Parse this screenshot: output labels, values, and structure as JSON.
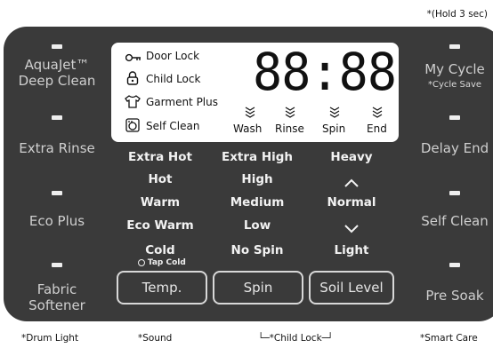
{
  "top_note": "*(Hold 3 sec)",
  "left": [
    {
      "label": "AquaJet™\nDeep Clean"
    },
    {
      "label": "Extra Rinse"
    },
    {
      "label": "Eco Plus"
    },
    {
      "label": "Fabric\nSoftener"
    }
  ],
  "right": [
    {
      "label": "My Cycle",
      "sub": "*Cycle Save"
    },
    {
      "label": "Delay End"
    },
    {
      "label": "Self Clean"
    },
    {
      "label": "Pre Soak"
    }
  ],
  "lcd": {
    "indicators": [
      "Door Lock",
      "Child Lock",
      "Garment Plus",
      "Self Clean"
    ],
    "time": "88:88",
    "stages": [
      "Wash",
      "Rinse",
      "Spin",
      "End"
    ]
  },
  "temp": [
    "Extra Hot",
    "Hot",
    "Warm",
    "Eco Warm",
    "Cold"
  ],
  "tap_cold": "Tap Cold",
  "spin": [
    "Extra High",
    "High",
    "Medium",
    "Low",
    "No Spin"
  ],
  "soil": [
    "Heavy",
    "^",
    "Normal",
    "v",
    "Light"
  ],
  "buttons": {
    "temp": "Temp.",
    "spin": "Spin",
    "soil": "Soil Level"
  },
  "bottom_notes": {
    "drum_light": "*Drum Light",
    "sound": "*Sound",
    "child_lock": "└─*Child Lock─┘",
    "smart_care": "*Smart Care"
  },
  "colors": {
    "panel": "#3a3a3a",
    "text": "#f2f2f2",
    "lcd": "#ffffff"
  },
  "icons": [
    "key-icon",
    "lock-icon",
    "shirt-icon",
    "drum-icon",
    "wave-arrow-icon"
  ]
}
